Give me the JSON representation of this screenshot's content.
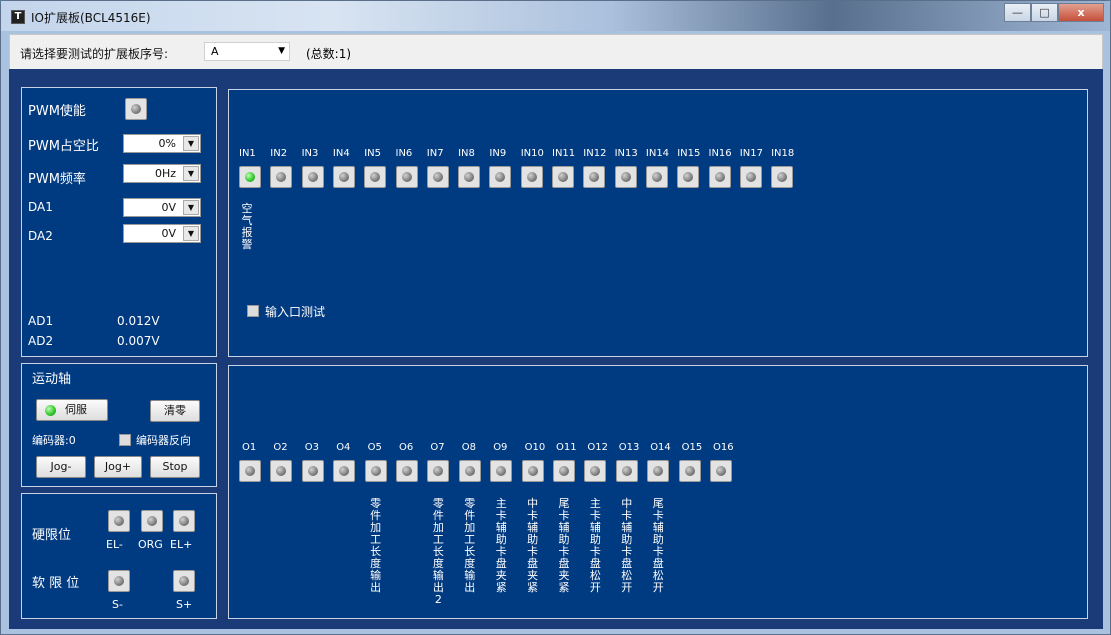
{
  "window": {
    "title": "IO扩展板(BCL4516E)",
    "icon_char": "T",
    "min": "—",
    "max": "□",
    "close": "x"
  },
  "toolbar": {
    "label": "请选择要测试的扩展板序号:",
    "selected": "A",
    "count": "(总数:1)"
  },
  "pwm": {
    "enable_label": "PWM使能",
    "duty_label": "PWM占空比",
    "duty_value": "0%",
    "freq_label": "PWM频率",
    "freq_value": "0Hz",
    "da1_label": "DA1",
    "da1_value": "0V",
    "da2_label": "DA2",
    "da2_value": "0V",
    "ad1_label": "AD1",
    "ad1_value": "0.012V",
    "ad2_label": "AD2",
    "ad2_value": "0.007V"
  },
  "inputs": {
    "channels": [
      "IN1",
      "IN2",
      "IN3",
      "IN4",
      "IN5",
      "IN6",
      "IN7",
      "IN8",
      "IN9",
      "IN10",
      "IN11",
      "IN12",
      "IN13",
      "IN14",
      "IN15",
      "IN16",
      "IN17",
      "IN18"
    ],
    "on": [
      true,
      false,
      false,
      false,
      false,
      false,
      false,
      false,
      false,
      false,
      false,
      false,
      false,
      false,
      false,
      false,
      false,
      false
    ],
    "in1_desc": "空气报警",
    "test_label": "输入口测试"
  },
  "motion": {
    "title": "运动轴",
    "servo_label": "伺服",
    "clear_label": "清零",
    "encoder_label": "编码器:0",
    "encoder_reverse_label": "编码器反向",
    "jog_minus": "Jog-",
    "jog_plus": "Jog+",
    "stop": "Stop"
  },
  "limits": {
    "hard_label": "硬限位",
    "soft_label": "软 限 位",
    "el_minus": "EL-",
    "org": "ORG",
    "el_plus": "EL+",
    "s_minus": "S-",
    "s_plus": "S+"
  },
  "outputs": {
    "channels": [
      "O1",
      "O2",
      "O3",
      "O4",
      "O5",
      "O6",
      "O7",
      "O8",
      "O9",
      "O10",
      "O11",
      "O12",
      "O13",
      "O14",
      "O15",
      "O16"
    ],
    "descriptions": {
      "O5": "零件加工长度输出",
      "O7": "零件加工长度输出2",
      "O8": "零件加工长度输出",
      "O9": "主卡辅助卡盘夹紧",
      "O10": "中卡辅助卡盘夹紧",
      "O11": "尾卡辅助卡盘夹紧",
      "O12": "主卡辅助卡盘松开",
      "O13": "中卡辅助卡盘松开",
      "O14": "尾卡辅助卡盘松开"
    }
  }
}
